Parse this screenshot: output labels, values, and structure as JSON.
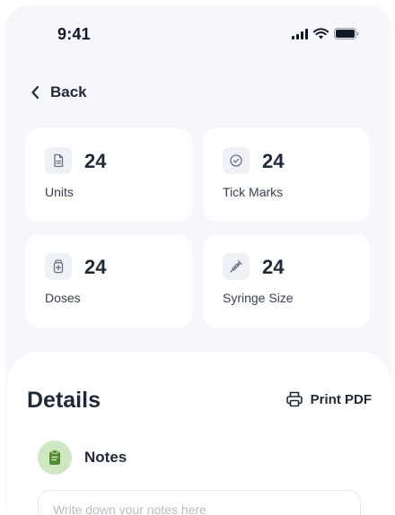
{
  "status_bar": {
    "time": "9:41"
  },
  "nav": {
    "back_label": "Back"
  },
  "stats": [
    {
      "value": "24",
      "label": "Units",
      "icon": "document-icon"
    },
    {
      "value": "24",
      "label": "Tick Marks",
      "icon": "check-circle-icon"
    },
    {
      "value": "24",
      "label": "Doses",
      "icon": "medicine-bottle-icon"
    },
    {
      "value": "24",
      "label": "Syringe Size",
      "icon": "syringe-icon"
    }
  ],
  "details": {
    "title": "Details",
    "print_label": "Print PDF",
    "notes_label": "Notes",
    "notes_value": "",
    "notes_placeholder": "Write down your notes here"
  },
  "colors": {
    "background": "#f5f7fa",
    "card": "#ffffff",
    "icon_box": "#eef1f5",
    "notes_icon_bg": "#cfe6c2",
    "notes_icon_fg": "#4f8a2f",
    "text": "#1f2937"
  }
}
